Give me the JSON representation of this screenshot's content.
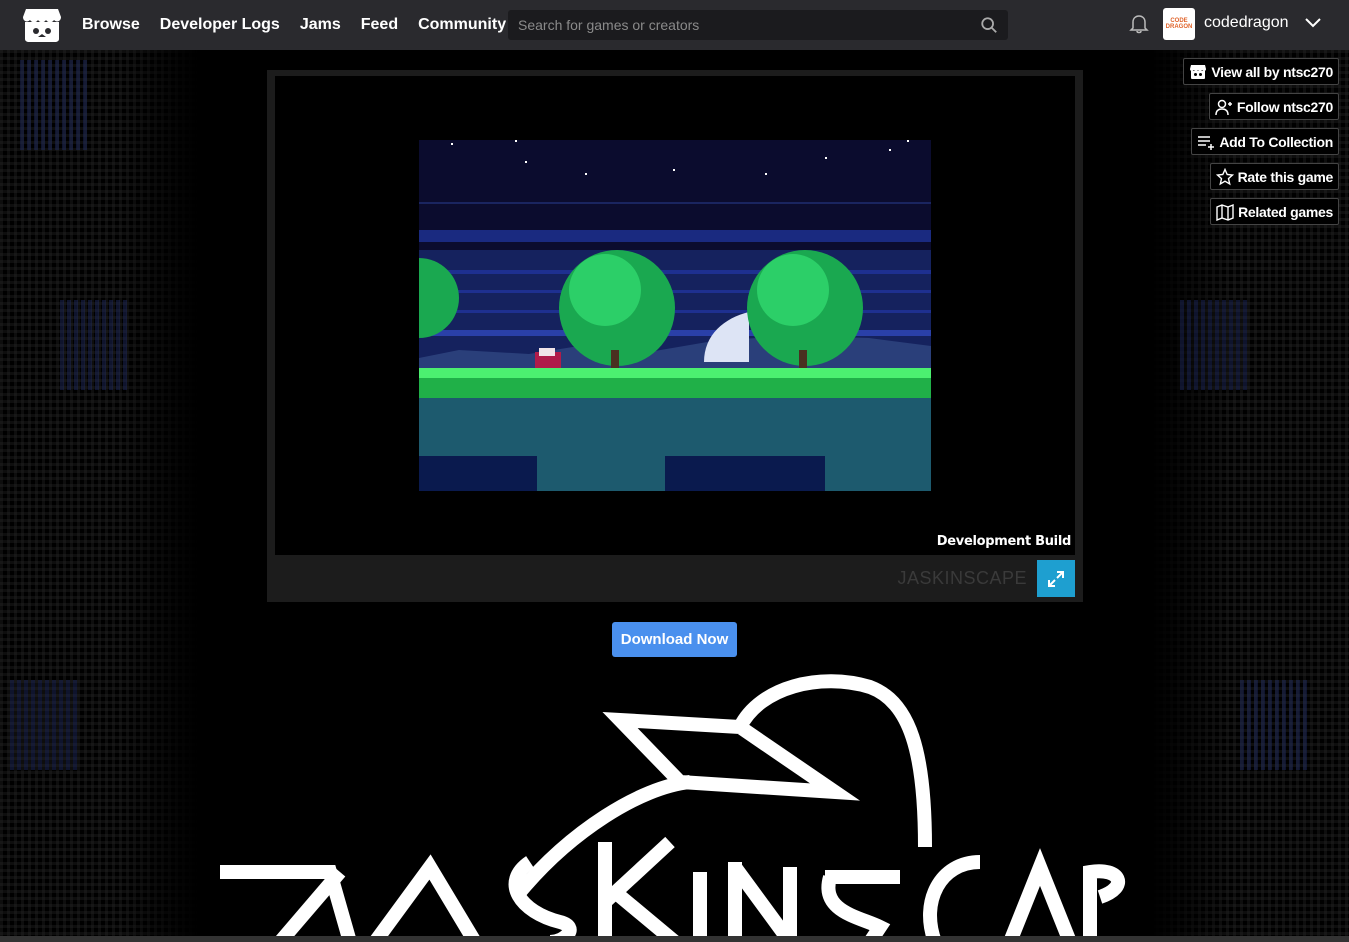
{
  "header": {
    "nav": [
      "Browse",
      "Developer Logs",
      "Jams",
      "Feed",
      "Community"
    ],
    "search_placeholder": "Search for games or creators",
    "username": "codedragon",
    "avatar_text": "CODE DRAGON"
  },
  "side_buttons": [
    {
      "label": "View all by ntsc270",
      "icon": "itchio-icon"
    },
    {
      "label": "Follow ntsc270",
      "icon": "user-plus-icon"
    },
    {
      "label": "Add To Collection",
      "icon": "playlist-add-icon"
    },
    {
      "label": "Rate this game",
      "icon": "star-icon"
    },
    {
      "label": "Related games",
      "icon": "map-icon"
    }
  ],
  "game": {
    "dev_build": "Development Build",
    "title": "JASKINSCAPE"
  },
  "download_label": "Download Now",
  "colors": {
    "header_bg": "#2a2a2e",
    "download_btn": "#4a90ee",
    "fullscreen_btn": "#1e9fd0"
  }
}
